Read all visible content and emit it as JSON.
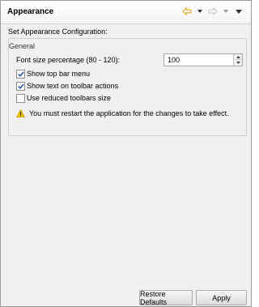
{
  "header": {
    "title": "Appearance"
  },
  "page": {
    "subtitle": "Set Appearance Configuration:"
  },
  "group": {
    "legend": "General",
    "font_size_label": "Font size percentage (80 - 120):",
    "font_size_value": "100",
    "options": [
      {
        "label": "Show top bar menu",
        "checked": true
      },
      {
        "label": "Show text on toolbar actions",
        "checked": true
      },
      {
        "label": "Use reduced toolbars size",
        "checked": false
      }
    ],
    "warning": "You must restart the application for the changes to take effect."
  },
  "buttons": {
    "restore_defaults": "Restore Defaults",
    "apply": "Apply"
  },
  "colors": {
    "accent_arrow": "#e8a623",
    "disabled_arrow": "#c8c8c8",
    "warning": "#f2c200"
  },
  "icons": [
    "back-arrow-icon",
    "forward-arrow-icon",
    "view-menu-icon",
    "check-icon",
    "warning-icon"
  ]
}
